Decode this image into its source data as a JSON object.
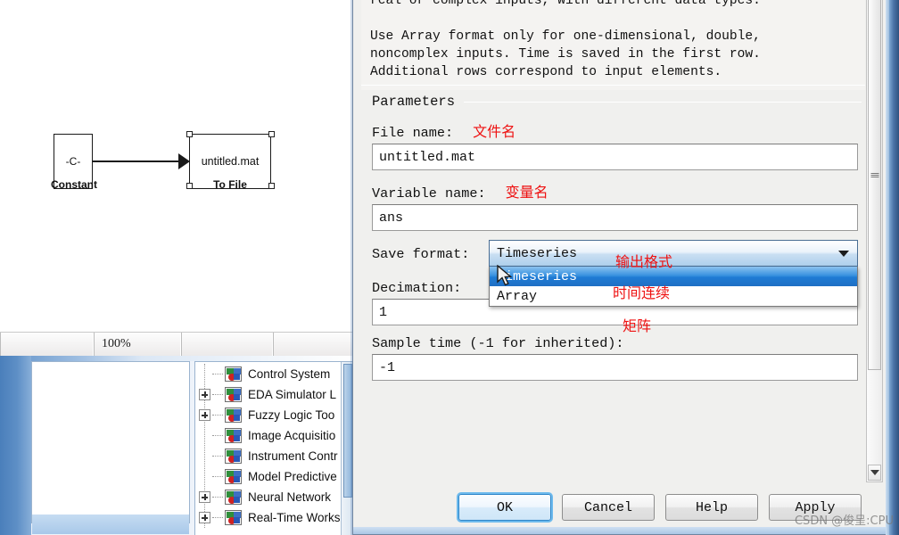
{
  "model": {
    "constant_block": {
      "symbol": "-C-",
      "label": "Constant"
    },
    "tofile_block": {
      "value": "untitled.mat",
      "label": "To File"
    }
  },
  "statusbar": {
    "zoom": "100%",
    "cell_blank_1": "",
    "cell_blank_2": ""
  },
  "library_tree": {
    "items": [
      {
        "label": "Control System ",
        "expandable": false
      },
      {
        "label": "EDA Simulator L",
        "expandable": true
      },
      {
        "label": "Fuzzy Logic Too",
        "expandable": true
      },
      {
        "label": "Image Acquisitio",
        "expandable": false
      },
      {
        "label": "Instrument Contr",
        "expandable": false
      },
      {
        "label": "Model Predictive",
        "expandable": false
      },
      {
        "label": "Neural Network",
        "expandable": true
      },
      {
        "label": "Real-Time Works",
        "expandable": true
      }
    ]
  },
  "dialog": {
    "description": {
      "line1": "real or complex inputs, with different data types.",
      "line2": "",
      "line3": "Use Array format only for one-dimensional, double,",
      "line4": "noncomplex inputs. Time is saved in the first row.",
      "line5": "Additional rows correspond to input elements."
    },
    "parameters_title": "Parameters",
    "file_name": {
      "label": "File name:",
      "annotation_cn": "文件名",
      "value": "untitled.mat"
    },
    "variable_name": {
      "label": "Variable name:",
      "annotation_cn": "变量名",
      "value": "ans"
    },
    "save_format": {
      "label": "Save format:",
      "value": "Timeseries",
      "annotation_cn": "输出格式",
      "options": [
        {
          "label": "Timeseries",
          "selected": true,
          "annotation_cn": "时间连续"
        },
        {
          "label": "Array",
          "selected": false,
          "annotation_cn": "矩阵"
        }
      ]
    },
    "decimation": {
      "label": "Decimation:",
      "value": "1"
    },
    "sample_time": {
      "label": "Sample time (-1 for inherited):",
      "value": "-1"
    },
    "buttons": {
      "ok": "OK",
      "cancel": "Cancel",
      "help": "Help",
      "apply": "Apply"
    }
  },
  "watermark": "CSDN @俊呈:CPU",
  "colors": {
    "accent_blue": "#1f7bd4",
    "annotation_red": "#ee1111",
    "dialog_bg": "#f0f0ee",
    "frame_blue": "#4a74a8"
  }
}
